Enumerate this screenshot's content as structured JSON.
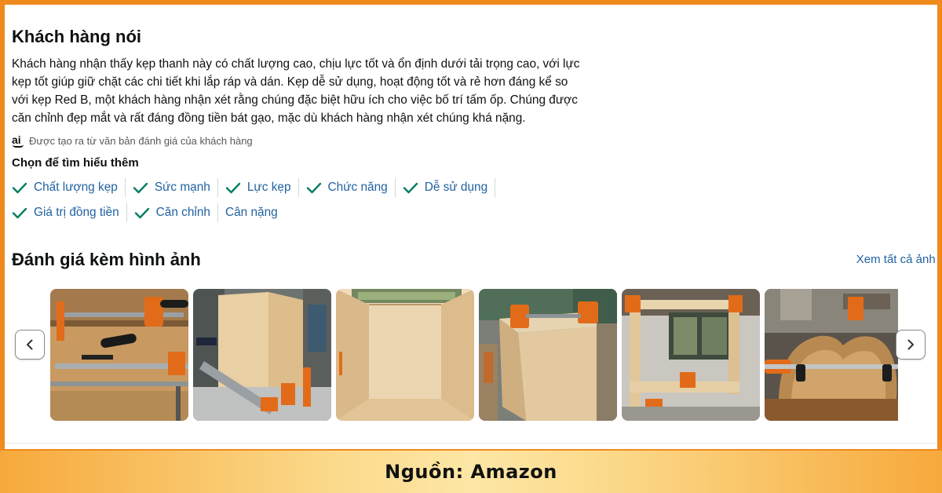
{
  "customers_say": {
    "title": "Khách hàng nói",
    "summary_lines": [
      "Khách hàng nhận thấy kẹp thanh này có chất lượng cao, chịu lực tốt và ổn định dưới tải trọng cao, với lực",
      "kẹp tốt giúp giữ chặt các chi tiết khi lắp ráp và dán. Kẹp dễ sử dụng, hoạt động tốt và rẻ hơn đáng kể so",
      "với kẹp Red B, một khách hàng nhận xét rằng chúng đặc biệt hữu ích cho việc bố trí tấm ốp. Chúng được",
      "căn chỉnh đẹp mắt và rất đáng đồng tiền bát gạo, mặc dù khách hàng nhận xét chúng khá nặng."
    ],
    "ai_icon_text": "ai",
    "ai_note": "Được tạo ra từ văn bản đánh giá của khách hàng",
    "learn_more_title": "Chọn để tìm hiểu thêm",
    "chips_row1": [
      {
        "label": "Chất lượng kẹp",
        "checked": true
      },
      {
        "label": "Sức mạnh",
        "checked": true
      },
      {
        "label": "Lực kẹp",
        "checked": true
      },
      {
        "label": "Chức năng",
        "checked": true
      },
      {
        "label": "Dễ sử dụng",
        "checked": true
      }
    ],
    "chips_row2": [
      {
        "label": "Giá trị đồng tiền",
        "checked": true
      },
      {
        "label": "Căn chỉnh",
        "checked": true
      },
      {
        "label": "Cân nặng",
        "checked": false
      }
    ]
  },
  "photo_reviews": {
    "title": "Đánh giá kèm hình ảnh",
    "see_all": "Xem tất cả ảnh",
    "photos": [
      {
        "subject": "bar clamps on workbench"
      },
      {
        "subject": "plywood panels clamped at corner"
      },
      {
        "subject": "plywood cabinet box interior"
      },
      {
        "subject": "cabinet box with corner clamps"
      },
      {
        "subject": "open wooden box frame with clamps"
      },
      {
        "subject": "curved wooden workpiece clamped"
      }
    ]
  },
  "footer": {
    "source": "Nguồn: Amazon"
  },
  "colors": {
    "accent_orange": "#f08a1c",
    "link_blue": "#2162a1",
    "check_teal": "#067d62"
  }
}
